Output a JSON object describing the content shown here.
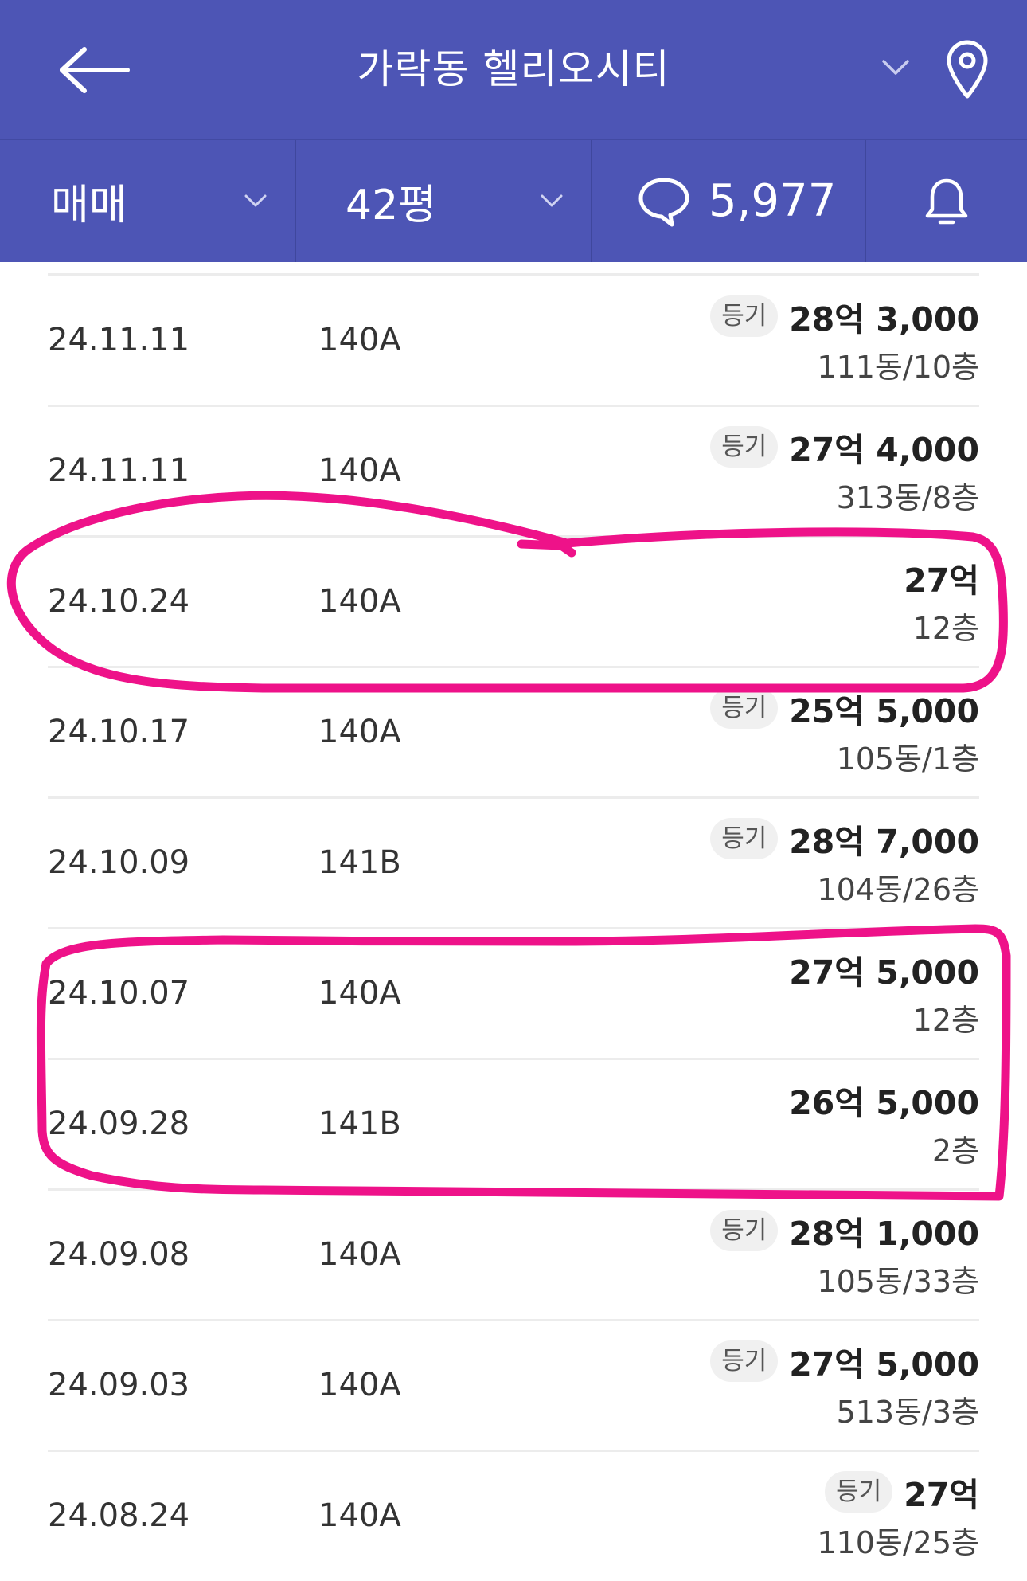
{
  "header": {
    "title": "가락동 헬리오시티"
  },
  "filters": {
    "deal_type": "매매",
    "area": "42평",
    "comments_count": "5,977"
  },
  "icons": {
    "back": "arrow-left-icon",
    "dropdown": "chevron-down-icon",
    "location": "map-pin-icon",
    "comment": "speech-bubble-icon",
    "alert": "bell-icon"
  },
  "colors": {
    "header_bg": "#4d55b5",
    "annotation": "#ee1289"
  },
  "transactions": [
    {
      "date": "24.11.11",
      "type": "140A",
      "badge": "등기",
      "price": "28억 3,000",
      "floor": "111동/10층"
    },
    {
      "date": "24.11.11",
      "type": "140A",
      "badge": "등기",
      "price": "27억 4,000",
      "floor": "313동/8층"
    },
    {
      "date": "24.10.24",
      "type": "140A",
      "badge": "",
      "price": "27억",
      "floor": "12층"
    },
    {
      "date": "24.10.17",
      "type": "140A",
      "badge": "등기",
      "price": "25억 5,000",
      "floor": "105동/1층"
    },
    {
      "date": "24.10.09",
      "type": "141B",
      "badge": "등기",
      "price": "28억 7,000",
      "floor": "104동/26층"
    },
    {
      "date": "24.10.07",
      "type": "140A",
      "badge": "",
      "price": "27억 5,000",
      "floor": "12층"
    },
    {
      "date": "24.09.28",
      "type": "141B",
      "badge": "",
      "price": "26억 5,000",
      "floor": "2층"
    },
    {
      "date": "24.09.08",
      "type": "140A",
      "badge": "등기",
      "price": "28억 1,000",
      "floor": "105동/33층"
    },
    {
      "date": "24.09.03",
      "type": "140A",
      "badge": "등기",
      "price": "27억 5,000",
      "floor": "513동/3층"
    },
    {
      "date": "24.08.24",
      "type": "140A",
      "badge": "등기",
      "price": "27억",
      "floor": "110동/25층"
    }
  ]
}
